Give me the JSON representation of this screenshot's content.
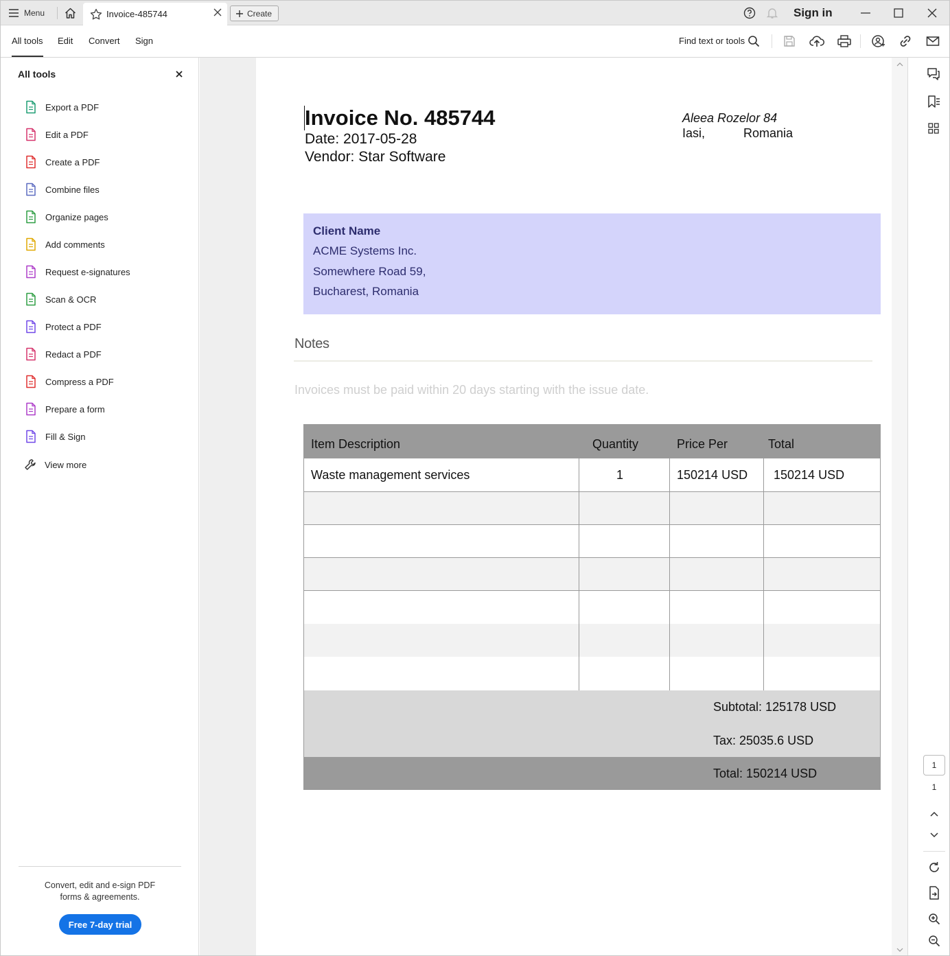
{
  "titlebar": {
    "menu_label": "Menu",
    "tab_title": "Invoice-485744",
    "create_label": "Create",
    "sign_in": "Sign in"
  },
  "toolbar": {
    "tabs": [
      "All tools",
      "Edit",
      "Convert",
      "Sign"
    ],
    "find_label": "Find text or tools"
  },
  "left_panel": {
    "title": "All tools",
    "tools": [
      {
        "label": "Export a PDF",
        "icon": "export-pdf-icon",
        "color": "#1e9e74"
      },
      {
        "label": "Edit a PDF",
        "icon": "edit-pdf-icon",
        "color": "#d6336c"
      },
      {
        "label": "Create a PDF",
        "icon": "create-pdf-icon",
        "color": "#e03131"
      },
      {
        "label": "Combine files",
        "icon": "combine-files-icon",
        "color": "#5c6bc0"
      },
      {
        "label": "Organize pages",
        "icon": "organize-pages-icon",
        "color": "#2f9e44"
      },
      {
        "label": "Add comments",
        "icon": "add-comments-icon",
        "color": "#e0a800"
      },
      {
        "label": "Request e-signatures",
        "icon": "request-esign-icon",
        "color": "#ae3ec9"
      },
      {
        "label": "Scan & OCR",
        "icon": "scan-ocr-icon",
        "color": "#2f9e44"
      },
      {
        "label": "Protect a PDF",
        "icon": "protect-pdf-icon",
        "color": "#7048e8"
      },
      {
        "label": "Redact a PDF",
        "icon": "redact-pdf-icon",
        "color": "#d6336c"
      },
      {
        "label": "Compress a PDF",
        "icon": "compress-pdf-icon",
        "color": "#e03131"
      },
      {
        "label": "Prepare a form",
        "icon": "prepare-form-icon",
        "color": "#ae3ec9"
      },
      {
        "label": "Fill & Sign",
        "icon": "fill-sign-icon",
        "color": "#7048e8"
      },
      {
        "label": "View more",
        "icon": "wrench-icon",
        "color": "#333333"
      }
    ],
    "promo_line1": "Convert, edit and e-sign PDF",
    "promo_line2": "forms & agreements.",
    "trial_button": "Free 7-day trial"
  },
  "invoice": {
    "title": "Invoice No. 485744",
    "date": "Date: 2017-05-28",
    "vendor": "Vendor: Star Software",
    "address_line1": "Aleea Rozelor 84",
    "address_city": "Iasi,",
    "address_country": "Romania",
    "client_heading": "Client Name",
    "client_name": "ACME Systems Inc.",
    "client_street": "Somewhere Road 59,",
    "client_city": "Bucharest, Romania",
    "notes_heading": "Notes",
    "notes_text": "Invoices must be paid within 20 days starting with the issue date.",
    "columns": [
      "Item Description",
      "Quantity",
      "Price Per",
      "Total"
    ],
    "rows": [
      {
        "description": "Waste management services",
        "quantity": "1",
        "price": "150214 USD",
        "total": "150214 USD"
      }
    ],
    "subtotal": "Subtotal: 125178 USD",
    "tax": "Tax: 25035.6 USD",
    "total": "Total: 150214 USD"
  },
  "page_nav": {
    "current_page": "1",
    "total_pages": "1"
  },
  "colors": {
    "accent": "#1473e6",
    "client_box": "#d4d4fb",
    "table_header": "#9a9a9a"
  }
}
